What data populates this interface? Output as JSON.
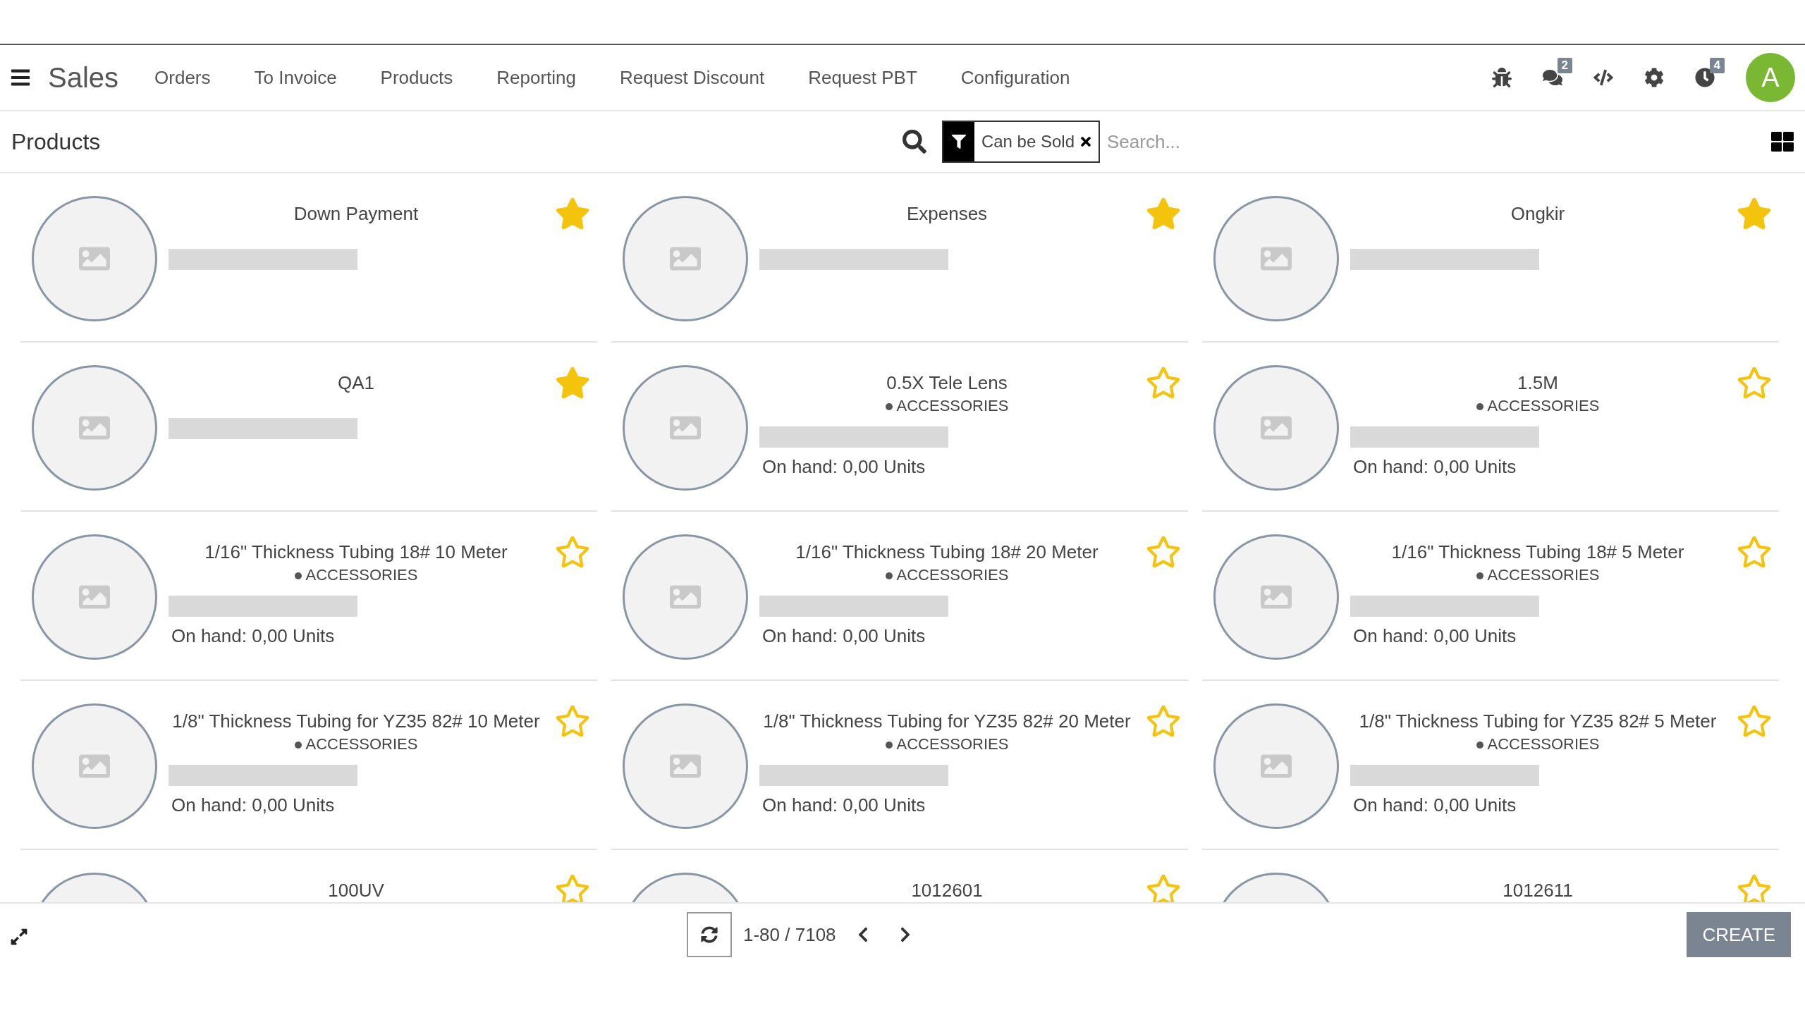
{
  "navbar": {
    "app": "Sales",
    "menu": [
      "Orders",
      "To Invoice",
      "Products",
      "Reporting",
      "Request Discount",
      "Request PBT",
      "Configuration"
    ],
    "messages_count": "2",
    "activities_count": "4",
    "avatar": "A"
  },
  "control_panel": {
    "title": "Products",
    "filter": "Can be Sold",
    "search": {
      "placeholder": "Search..."
    }
  },
  "products": [
    {
      "name": "Down Payment",
      "favorite": true
    },
    {
      "name": "Expenses",
      "favorite": true
    },
    {
      "name": "Ongkir",
      "favorite": true
    },
    {
      "name": "QA1",
      "favorite": true
    },
    {
      "name": "0.5X Tele Lens",
      "category": "ACCESSORIES",
      "on_hand": "On hand: 0,00 Units",
      "favorite": false
    },
    {
      "name": "1.5M",
      "category": "ACCESSORIES",
      "on_hand": "On hand: 0,00 Units",
      "favorite": false
    },
    {
      "name": "1/16\" Thickness Tubing 18# 10 Meter",
      "category": "ACCESSORIES",
      "on_hand": "On hand: 0,00 Units",
      "favorite": false
    },
    {
      "name": "1/16\" Thickness Tubing 18# 20 Meter",
      "category": "ACCESSORIES",
      "on_hand": "On hand: 0,00 Units",
      "favorite": false
    },
    {
      "name": "1/16\" Thickness Tubing 18# 5 Meter",
      "category": "ACCESSORIES",
      "on_hand": "On hand: 0,00 Units",
      "favorite": false
    },
    {
      "name": "1/8\" Thickness Tubing for YZ35 82# 10 Meter",
      "category": "ACCESSORIES",
      "on_hand": "On hand: 0,00 Units",
      "favorite": false
    },
    {
      "name": "1/8\" Thickness Tubing for YZ35 82# 20 Meter",
      "category": "ACCESSORIES",
      "on_hand": "On hand: 0,00 Units",
      "favorite": false
    },
    {
      "name": "1/8\" Thickness Tubing for YZ35 82# 5 Meter",
      "category": "ACCESSORIES",
      "on_hand": "On hand: 0,00 Units",
      "favorite": false
    },
    {
      "name": "100UV",
      "favorite": false
    },
    {
      "name": "1012601",
      "favorite": false
    },
    {
      "name": "1012611",
      "favorite": false
    }
  ],
  "pager": {
    "range": "1-80 / 7108"
  },
  "create_button": "CREATE"
}
